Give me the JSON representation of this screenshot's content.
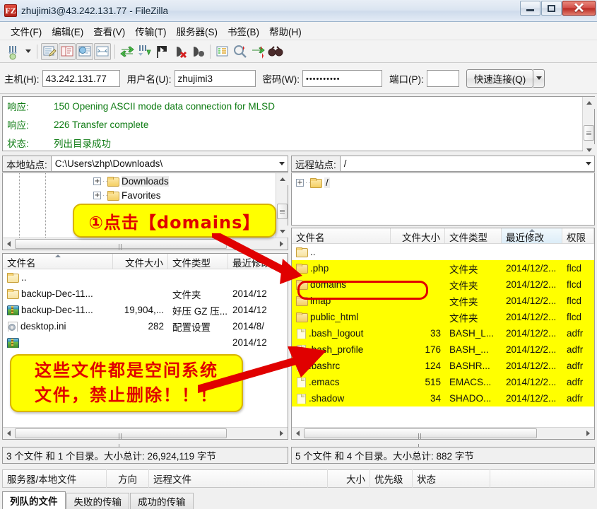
{
  "window": {
    "title": "zhujimi3@43.242.131.77 - FileZilla",
    "app_icon": "filezilla-icon",
    "minimize": "minimize-icon",
    "maximize": "maximize-icon",
    "close": "✕"
  },
  "menu": [
    "文件(F)",
    "编辑(E)",
    "查看(V)",
    "传输(T)",
    "服务器(S)",
    "书签(B)",
    "帮助(H)"
  ],
  "toolbar": {
    "icons": [
      "site-manager-icon",
      "dropdown-caret-icon",
      "toggle-message-log-icon",
      "toggle-local-tree-icon",
      "toggle-remote-tree-icon",
      "toggle-transfer-queue-icon",
      "refresh-icon",
      "process-queue-icon",
      "cancel-operation-icon",
      "disconnect-icon",
      "reconnect-icon",
      "filter-icon",
      "compare-icon",
      "sync-browsing-icon",
      "search-icon"
    ]
  },
  "quickconnect": {
    "host_label": "主机(H):",
    "host_value": "43.242.131.77",
    "user_label": "用户名(U):",
    "user_value": "zhujimi3",
    "pass_label": "密码(W):",
    "pass_value": "••••••••••",
    "port_label": "端口(P):",
    "port_value": "",
    "connect_label": "快速连接(Q)",
    "dropdown_icon": "chevron-down-icon"
  },
  "log": {
    "rows": [
      {
        "kind": "响应:",
        "message": "150 Opening ASCII mode data connection for MLSD"
      },
      {
        "kind": "响应:",
        "message": "226 Transfer complete"
      },
      {
        "kind": "状态:",
        "message": "列出目录成功"
      }
    ],
    "color": "#0d7b12"
  },
  "local": {
    "site_label": "本地站点:",
    "site_path": "C:\\Users\\zhp\\Downloads\\",
    "tree": [
      {
        "label": "Downloads",
        "icon": "folder-download-icon",
        "selected": true
      },
      {
        "label": "Favorites",
        "icon": "folder-favorites-icon",
        "selected": false
      }
    ],
    "columns": [
      {
        "label": "文件名",
        "sorted": true
      },
      {
        "label": "文件大小",
        "sorted": false
      },
      {
        "label": "文件类型",
        "sorted": false
      },
      {
        "label": "最近修改",
        "sorted": false
      }
    ],
    "rows": [
      {
        "icon": "folder-icon",
        "name": "..",
        "size": "",
        "type": "",
        "modified": ""
      },
      {
        "icon": "folder-icon",
        "name": "backup-Dec-11...",
        "size": "",
        "type": "文件夹",
        "modified": "2014/12"
      },
      {
        "icon": "archive-icon",
        "name": "backup-Dec-11...",
        "size": "19,904,...",
        "type": "好压 GZ 压...",
        "modified": "2014/12"
      },
      {
        "icon": "config-icon",
        "name": "desktop.ini",
        "size": "282",
        "type": "配置设置",
        "modified": "2014/8/"
      },
      {
        "icon": "archive-icon",
        "name": "",
        "size": "",
        "type": "",
        "modified": "2014/12"
      }
    ],
    "status": "3 个文件 和 1 个目录。大小总计: 26,924,119 字节"
  },
  "remote": {
    "site_label": "远程站点:",
    "site_path": "/",
    "tree": [
      {
        "label": "/",
        "icon": "folder-icon"
      }
    ],
    "columns": [
      {
        "label": "文件名",
        "sorted": false
      },
      {
        "label": "文件大小",
        "sorted": false
      },
      {
        "label": "文件类型",
        "sorted": false
      },
      {
        "label": "最近修改",
        "sorted": true
      },
      {
        "label": "权限",
        "sorted": false
      }
    ],
    "rows": [
      {
        "icon": "folder-icon",
        "name": "..",
        "size": "",
        "type": "",
        "modified": "",
        "perm": "",
        "highlight": false
      },
      {
        "icon": "folder-icon",
        "name": ".php",
        "size": "",
        "type": "文件夹",
        "modified": "2014/12/2...",
        "perm": "flcd",
        "highlight": true
      },
      {
        "icon": "folder-icon",
        "name": "domains",
        "size": "",
        "type": "文件夹",
        "modified": "2014/12/2...",
        "perm": "flcd",
        "highlight": true
      },
      {
        "icon": "folder-icon",
        "name": "imap",
        "size": "",
        "type": "文件夹",
        "modified": "2014/12/2...",
        "perm": "flcd",
        "highlight": true
      },
      {
        "icon": "folder-icon",
        "name": "public_html",
        "size": "",
        "type": "文件夹",
        "modified": "2014/12/2...",
        "perm": "flcd",
        "highlight": true
      },
      {
        "icon": "file-icon",
        "name": ".bash_logout",
        "size": "33",
        "type": "BASH_L...",
        "modified": "2014/12/2...",
        "perm": "adfr",
        "highlight": true
      },
      {
        "icon": "file-icon",
        "name": ".bash_profile",
        "size": "176",
        "type": "BASH_...",
        "modified": "2014/12/2...",
        "perm": "adfr",
        "highlight": true
      },
      {
        "icon": "file-icon",
        "name": ".bashrc",
        "size": "124",
        "type": "BASHR...",
        "modified": "2014/12/2...",
        "perm": "adfr",
        "highlight": true
      },
      {
        "icon": "file-icon",
        "name": ".emacs",
        "size": "515",
        "type": "EMACS...",
        "modified": "2014/12/2...",
        "perm": "adfr",
        "highlight": true
      },
      {
        "icon": "file-icon",
        "name": ".shadow",
        "size": "34",
        "type": "SHADO...",
        "modified": "2014/12/2...",
        "perm": "adfr",
        "highlight": true
      }
    ],
    "status": "5 个文件 和 4 个目录。大小总计: 882 字节"
  },
  "queue": {
    "columns": [
      "服务器/本地文件",
      "方向",
      "远程文件",
      "大小",
      "优先级",
      "状态"
    ],
    "tabs": [
      {
        "label": "列队的文件",
        "active": true
      },
      {
        "label": "失败的传输",
        "active": false
      },
      {
        "label": "成功的传输",
        "active": false
      }
    ]
  },
  "annotations": {
    "callout1": "①点击【domains】",
    "callout2_line1": "这些文件都是空间系统",
    "callout2_line2": "文件，禁止删除！！！",
    "highlight_color": "#ffff00",
    "text_color": "#e00000",
    "arrow_color": "#e00000"
  }
}
